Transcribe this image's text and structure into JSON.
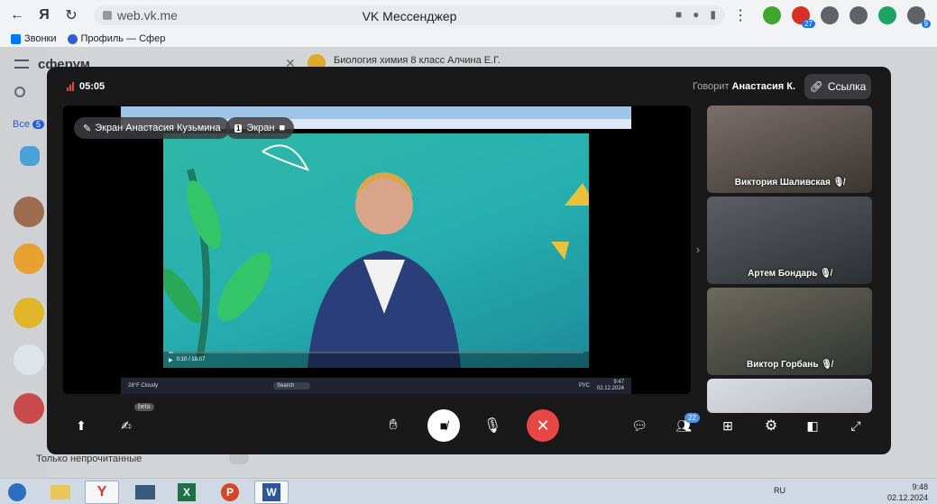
{
  "browser": {
    "url": "web.vk.me",
    "tab_title": "VK Мессенджер",
    "bookmarks": [
      {
        "label": "Звонки",
        "color": "#0077ff"
      },
      {
        "label": "Профиль — Сфер",
        "color": "#2f5fd0"
      }
    ],
    "extensions": [
      {
        "name": "smiley-extension-icon",
        "color": "#3fa52f",
        "text": ""
      },
      {
        "name": "record-extension-icon",
        "color": "#d93025",
        "text": "27"
      },
      {
        "name": "puzzle-icon",
        "color": "#5f6368",
        "text": ""
      },
      {
        "name": "reading-list-icon",
        "color": "#5f6368",
        "text": ""
      },
      {
        "name": "play-extension-icon",
        "color": "#1ea362",
        "text": ""
      },
      {
        "name": "download-icon",
        "color": "#5f6368",
        "text": "9"
      }
    ]
  },
  "app": {
    "brand": "сферум",
    "all_chats_label": "Все",
    "all_chats_count": "5",
    "chat_title": "Биология химия 8 класс Алчина Е.Г.",
    "footer_option": "Только непрочитанные"
  },
  "call": {
    "timer": "05:05",
    "speaking_label": "Говорит",
    "speaker_name": "Анастасия К.",
    "link_button": "Ссылка",
    "screen_label": "Экран Анастасия Кузьмина",
    "screen_chip_number": "1",
    "screen_chip_label": "Экран",
    "shared_video": {
      "time": "0:10 / 18:07",
      "progress_fraction": 0.01,
      "taskbar_weather": "28°F Cloudy",
      "taskbar_search": "Search",
      "taskbar_lang": "РУС",
      "taskbar_time": "9:47",
      "taskbar_date": "02.12.2024"
    },
    "participants": [
      {
        "name": "Виктория Шаливская",
        "muted": true,
        "colors": [
          "#7a6f6a",
          "#3b3532"
        ]
      },
      {
        "name": "Артем Бондарь",
        "muted": true,
        "colors": [
          "#5b5f63",
          "#2c2f33"
        ]
      },
      {
        "name": "Виктор Горбань",
        "muted": true,
        "colors": [
          "#6c6a5d",
          "#2f3331"
        ]
      },
      {
        "name": "",
        "muted": false,
        "colors": [
          "#d9dde3",
          "#b8bcc2"
        ]
      }
    ],
    "controls": {
      "beta_label": "beta",
      "participants_count": "22",
      "end_call_color": "#e64646"
    }
  },
  "taskbar": {
    "lang": "RU",
    "time": "9:48",
    "date": "02.12.2024"
  }
}
